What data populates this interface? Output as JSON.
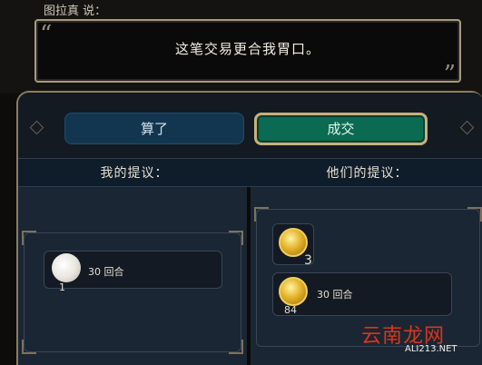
{
  "dialog": {
    "speaker": "图拉真 说：",
    "open_quote": "“",
    "close_quote": "”",
    "quote": "这笔交易更合我胃口。"
  },
  "buttons": {
    "cancel": "算了",
    "accept": "成交"
  },
  "headers": {
    "my_offer": "我的提议：",
    "their_offer": "他们的提议："
  },
  "my_offer": {
    "items": [
      {
        "icon": "cotton-icon",
        "count": "1",
        "label": "30 回合"
      }
    ]
  },
  "their_offer": {
    "items": [
      {
        "icon": "gold-coins-icon",
        "count": "3",
        "label": ""
      },
      {
        "icon": "gold-coins-icon",
        "count": "84",
        "label": "30 回合"
      }
    ]
  },
  "watermark": {
    "main": "云南龙网",
    "sub": "ALI213.NET"
  },
  "colors": {
    "accept_green": "#0b6a52",
    "cancel_blue": "#123650",
    "frame_gold": "#c8b07a"
  }
}
